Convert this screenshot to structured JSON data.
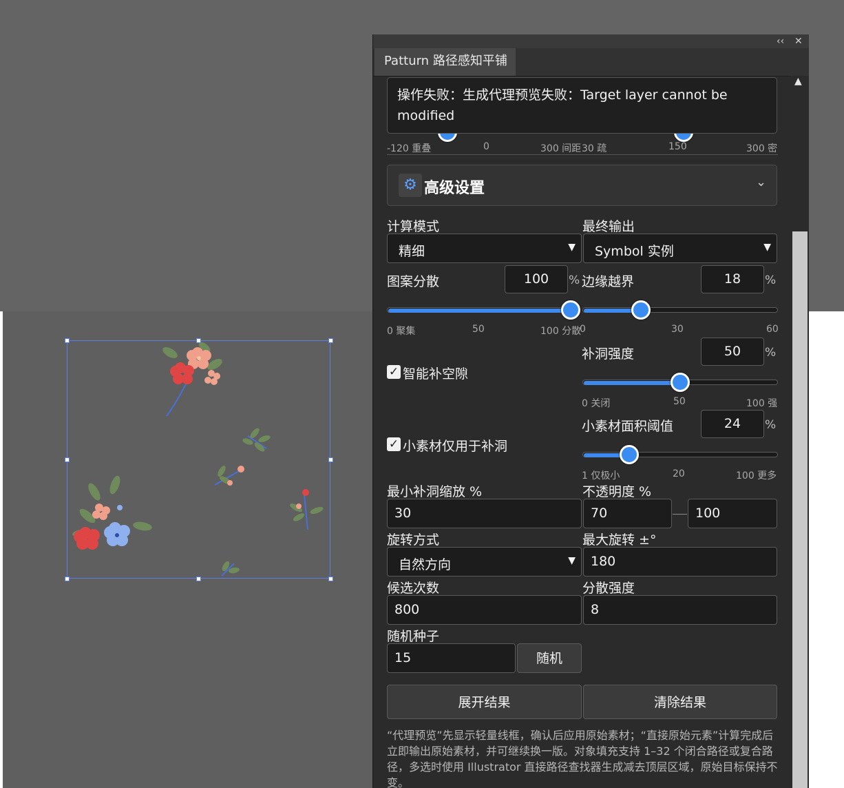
{
  "panel": {
    "tab_title": "Patturn 路径感知平铺",
    "collapse_icon": "‹‹",
    "close_icon": "✕",
    "error_message": "操作失败：生成代理预览失败：Target layer cannot be modified",
    "prev_ticks_a": [
      "-120 重叠",
      "0",
      "300 间距"
    ],
    "prev_ticks_b": [
      "30 疏",
      "150",
      "300 密"
    ],
    "advanced": {
      "title": "高级设置",
      "icon": "gear-icon",
      "chevron": "chevron-down-icon"
    },
    "calc_mode": {
      "label": "计算模式",
      "value": "精细"
    },
    "final_output": {
      "label": "最终输出",
      "value": "Symbol 实例"
    },
    "pattern_scatter": {
      "label": "图案分散",
      "value": "100",
      "unit": "%",
      "ticks": [
        "0 聚集",
        "50",
        "100 分散"
      ],
      "level": 1.0
    },
    "edge_overflow": {
      "label": "边缘越界",
      "value": "18",
      "unit": "%",
      "ticks": [
        "0",
        "30",
        "60"
      ],
      "level": 0.3
    },
    "smart_fill": {
      "label": "智能补空隙",
      "checked": true
    },
    "fill_strength": {
      "label": "补洞强度",
      "value": "50",
      "unit": "%",
      "ticks": [
        "0 关闭",
        "50",
        "100 强"
      ],
      "level": 0.5
    },
    "small_only": {
      "label": "小素材仅用于补洞",
      "checked": true
    },
    "small_area": {
      "label": "小素材面积阈值",
      "value": "24",
      "unit": "%",
      "ticks": [
        "1 仅极小",
        "20",
        "100 更多"
      ],
      "level": 0.24
    },
    "min_fill_scale": {
      "label": "最小补洞缩放 %",
      "value": "30"
    },
    "opacity": {
      "label": "不透明度 %",
      "min": "70",
      "max": "100"
    },
    "rotation_mode": {
      "label": "旋转方式",
      "value": "自然方向"
    },
    "max_rotation": {
      "label": "最大旋转 ±°",
      "value": "180"
    },
    "candidates": {
      "label": "候选次数",
      "value": "800"
    },
    "scatter_strength": {
      "label": "分散强度",
      "value": "8"
    },
    "seed": {
      "label": "随机种子",
      "value": "15",
      "random_label": "随机"
    },
    "expand_label": "展开结果",
    "clear_label": "清除结果",
    "help_text": "“代理预览”先显示轻量线框，确认后应用原始素材；“直接原始元素”计算完成后立即输出原始素材，并可继续换一版。对象填充支持 1–32 个闭合路径或复合路径，多选时使用 Illustrator 直接路径查找器生成减去顶层区域，原始目标保持不变。"
  }
}
